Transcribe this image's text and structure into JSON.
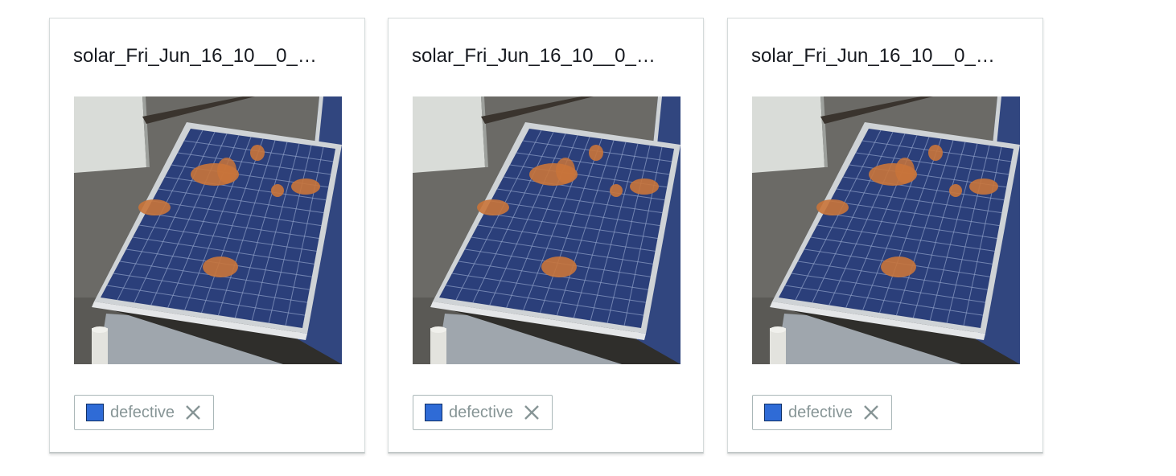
{
  "cards": [
    {
      "title": "solar_Fri_Jun_16_10__0_…",
      "image_icon": "solar-panel-image",
      "label": {
        "text": "defective",
        "color": "#2f6bd6",
        "remove_icon": "close-icon"
      }
    },
    {
      "title": "solar_Fri_Jun_16_10__0_…",
      "image_icon": "solar-panel-image",
      "label": {
        "text": "defective",
        "color": "#2f6bd6",
        "remove_icon": "close-icon"
      }
    },
    {
      "title": "solar_Fri_Jun_16_10__0_…",
      "image_icon": "solar-panel-image",
      "label": {
        "text": "defective",
        "color": "#2f6bd6",
        "remove_icon": "close-icon"
      }
    }
  ],
  "colors": {
    "panel_blue": "#2b3f7a",
    "defect_orange": "#c9743a",
    "ground_gray": "#6b6a66",
    "card_border": "#d5dbdb"
  }
}
